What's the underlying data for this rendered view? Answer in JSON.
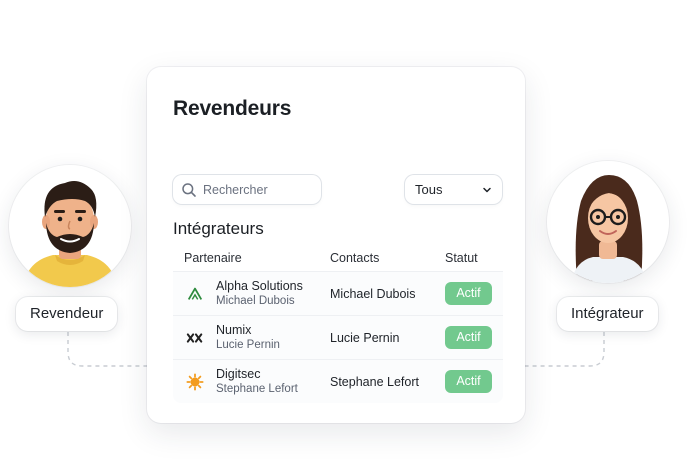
{
  "roles": {
    "left": "Revendeur",
    "right": "Intégrateur"
  },
  "card": {
    "title": "Revendeurs",
    "search_placeholder": "Rechercher",
    "filter_value": "Tous",
    "section_title": "Intégrateurs",
    "columns": [
      "Partenaire",
      "Contacts",
      "Statut"
    ],
    "rows": [
      {
        "name": "Alpha Solutions",
        "sub": "Michael Dubois",
        "contact": "Michael Dubois",
        "status": "Actif",
        "logo": "alpha-logo-icon"
      },
      {
        "name": "Numix",
        "sub": "Lucie Pernin",
        "contact": "Lucie Pernin",
        "status": "Actif",
        "logo": "numix-logo-icon"
      },
      {
        "name": "Digitsec",
        "sub": "Stephane Lefort",
        "contact": "Stephane Lefort",
        "status": "Actif",
        "logo": "digitsec-logo-icon"
      }
    ]
  },
  "colors": {
    "status_active": "#72c98e",
    "alpha_logo": "#2e8b3e",
    "digitsec_logo": "#f39c1f"
  }
}
